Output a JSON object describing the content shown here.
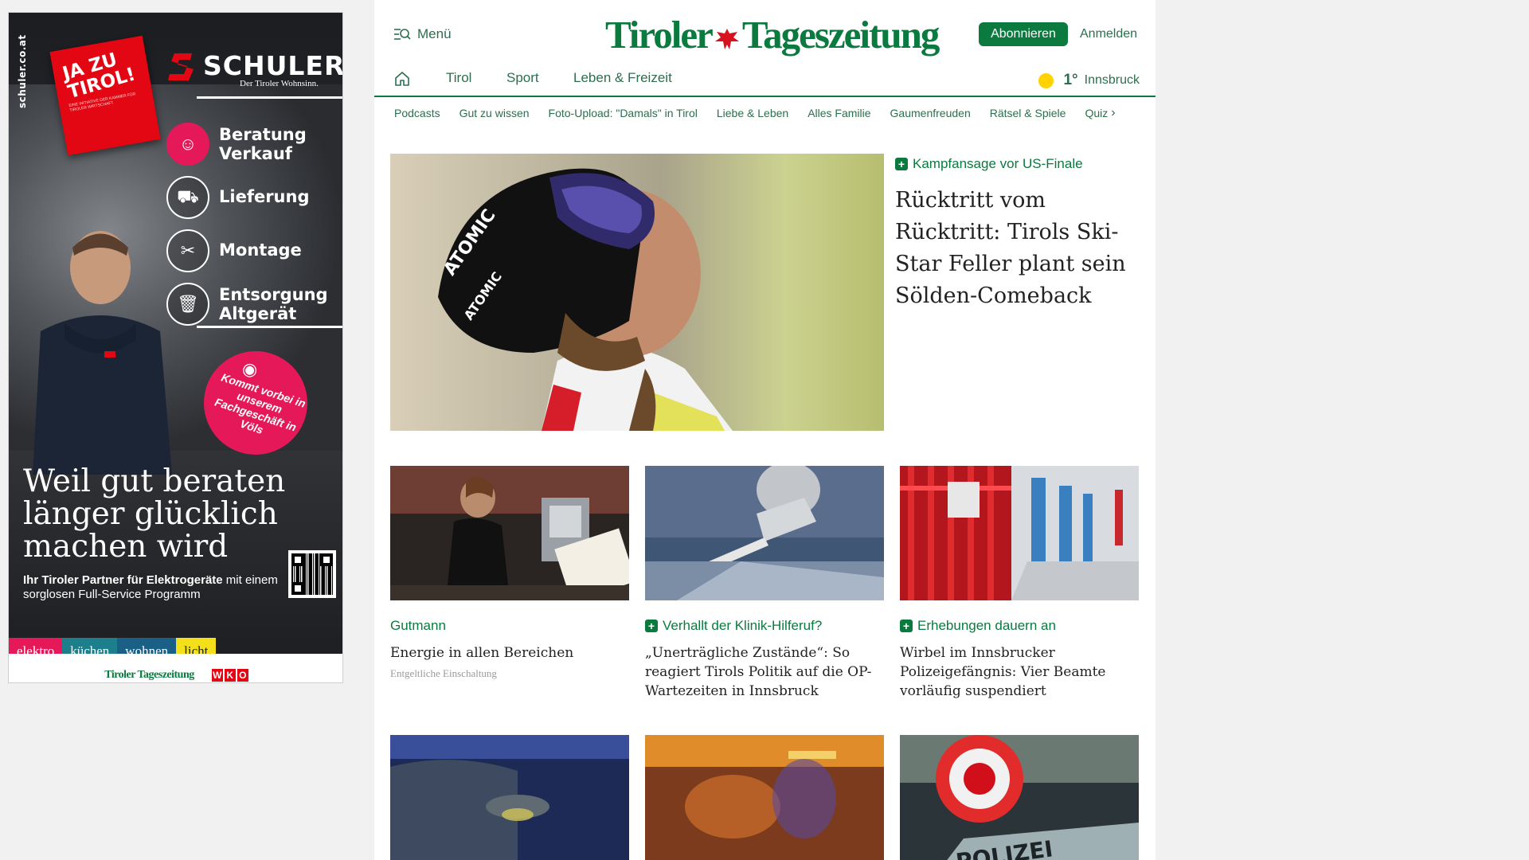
{
  "ad": {
    "side_text": "schuler.co.at",
    "badge": "JA ZU TIROL!",
    "badge_small": "EINE INITIATIVE DER KAMMER FÜR TIROLER WIRTSCHAFT",
    "brand_name": "SCHULER",
    "brand_tagline": "Der Tiroler Wohnsinn.",
    "services": [
      "Beratung Verkauf",
      "Lieferung",
      "Montage",
      "Entsorgung Altgerät"
    ],
    "service_line1": [
      "Beratung",
      "Lieferung",
      "Montage",
      "Entsorgung"
    ],
    "service_line2": [
      "Verkauf",
      "",
      "",
      "Altgerät"
    ],
    "promo": "Kommt vorbei in unserem Fachgeschäft in Völs",
    "headline": "Weil gut beraten länger glücklich machen wird",
    "sub_bold": "Ihr Tiroler Partner für Elektrogeräte",
    "sub_rest": " mit einem sorglosen Full-Service Programm",
    "categories": [
      "elektro",
      "küchen",
      "wohnen",
      "licht"
    ],
    "category_colors": [
      "#e5195a",
      "#1e7f8c",
      "#1a5f86",
      "#f4e01a"
    ],
    "footer_logo": "Tiroler Tageszeitung",
    "wko": [
      "W",
      "K",
      "O"
    ]
  },
  "header": {
    "menu_label": "Menü",
    "logo": "Tiroler Tageszeitung",
    "logo_left": "Tiroler",
    "logo_right": "Tageszeitung",
    "subscribe_label": "Abonnieren",
    "login_label": "Anmelden"
  },
  "nav": {
    "items": [
      "Tirol",
      "Sport",
      "Leben & Freizeit"
    ],
    "weather_temp": "1°",
    "weather_city": "Innsbruck"
  },
  "subnav": [
    "Podcasts",
    "Gut zu wissen",
    "Foto-Upload: \"Damals\" in Tirol",
    "Liebe & Leben",
    "Alles Familie",
    "Gaumenfreuden",
    "Rätsel & Spiele",
    "Quiz"
  ],
  "hero": {
    "kicker": "Kampfansage vor US-Finale",
    "title": "Rücktritt vom Rücktritt: Tirols Ski-Star Feller plant sein Sölden-Comeback"
  },
  "cards": [
    {
      "kicker": "Gutmann",
      "title": "Energie in allen Bereichen",
      "note": "Entgeltliche Einschaltung",
      "plus": false
    },
    {
      "kicker": "Verhallt der Klinik-Hilferuf?",
      "title": "„Unerträgliche Zustände“: So reagiert Tirols Politik auf die OP-Wartezeiten in Innsbruck",
      "note": "",
      "plus": true
    },
    {
      "kicker": "Erhebungen dauern an",
      "title": "Wirbel im Innsbrucker Polizeigefängnis: Vier Beamte vorläufig suspendiert",
      "note": "",
      "plus": true
    }
  ],
  "colors": {
    "brand_green": "#0a7a3f",
    "link_green": "#2d6e4e"
  },
  "icons": [
    "menu-search-icon",
    "home-icon",
    "sun-icon",
    "plus-icon",
    "chevron-right-icon"
  ]
}
